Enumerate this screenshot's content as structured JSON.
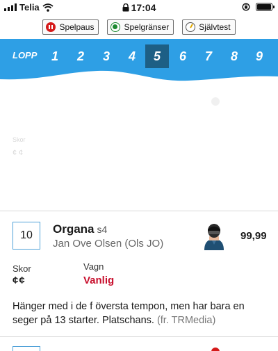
{
  "status_bar": {
    "carrier": "Telia",
    "time": "17:04",
    "icons": [
      "signal-icon",
      "wifi-icon",
      "lock-icon",
      "orientation-lock-icon",
      "battery-icon"
    ]
  },
  "safety_bar": {
    "pause_label": "Spelpaus",
    "limits_label": "Spelgränser",
    "selftest_label": "Självtest"
  },
  "race_bar": {
    "label": "LOPP",
    "tabs": [
      "1",
      "2",
      "3",
      "4",
      "5",
      "6",
      "7",
      "8",
      "9"
    ],
    "active_tab": "5",
    "background": "#2e9fe5",
    "active_background": "#1d5f85"
  },
  "faded": {
    "line1": "Skor",
    "line2": "¢ ¢"
  },
  "starter": {
    "number": "10",
    "name": "Organa",
    "name_suffix": "s4",
    "driver": "Jan Ove Olsen (Ols JO)",
    "odds": "99,99",
    "skor_label": "Skor",
    "skor_value": "¢¢",
    "vagn_label": "Vagn",
    "vagn_value": "Vanlig",
    "comment": "Hänger med i de f översta tempon, men har bara en seger på 13 starter. Platschans.",
    "comment_source": "(fr. TRMedia)",
    "accent_red": "#c8102e"
  }
}
